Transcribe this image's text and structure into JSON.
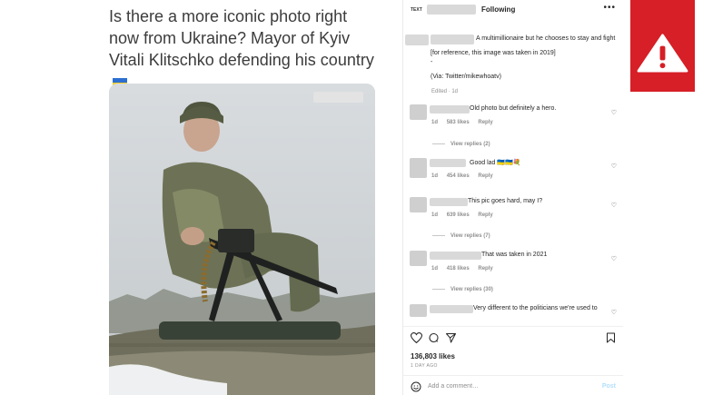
{
  "tweet": {
    "text": "Is there a more iconic photo right now from Ukraine? Mayor of Kyiv Vitali Klitschko defending his country"
  },
  "instagram": {
    "header": {
      "small_label": "TEXT",
      "following_label": "Following",
      "more_label": "•••"
    },
    "caption": {
      "line1": "A multimillionaire but he chooses to stay and fight",
      "line2": "[for reference, this image was taken in 2019]",
      "line3": "-",
      "line4": "(Via: Twitter/mikewhoatv)",
      "edited": "Edited · 1d"
    },
    "comments": [
      {
        "text": "Old photo but definitely a hero.",
        "time": "1d",
        "likes": "583 likes",
        "reply": "Reply",
        "view_replies": "View replies (2)"
      },
      {
        "text": "Good lad 🇺🇦🇺🇦💐",
        "time": "1d",
        "likes": "454 likes",
        "reply": "Reply",
        "view_replies": ""
      },
      {
        "text": "This pic goes hard, may I?",
        "time": "1d",
        "likes": "639 likes",
        "reply": "Reply",
        "view_replies": "View replies (7)"
      },
      {
        "text": "That was taken in 2021",
        "time": "1d",
        "likes": "418 likes",
        "reply": "Reply",
        "view_replies": "View replies (30)"
      },
      {
        "text": "Very different to the politicians we're used to",
        "time": "",
        "likes": "",
        "reply": "",
        "view_replies": ""
      }
    ],
    "likes_count": "136,803 likes",
    "time_ago": "1 DAY AGO",
    "add_comment_placeholder": "Add a comment…",
    "post_label": "Post"
  },
  "colors": {
    "warning_red": "#d61f26",
    "ukraine_blue": "#2d6fd1",
    "ukraine_yellow": "#f5cf2a",
    "post_blue": "#b2dffc"
  },
  "icons": [
    "heart-icon",
    "comment-icon",
    "share-icon",
    "bookmark-icon",
    "smile-icon",
    "warning-icon",
    "more-icon"
  ]
}
